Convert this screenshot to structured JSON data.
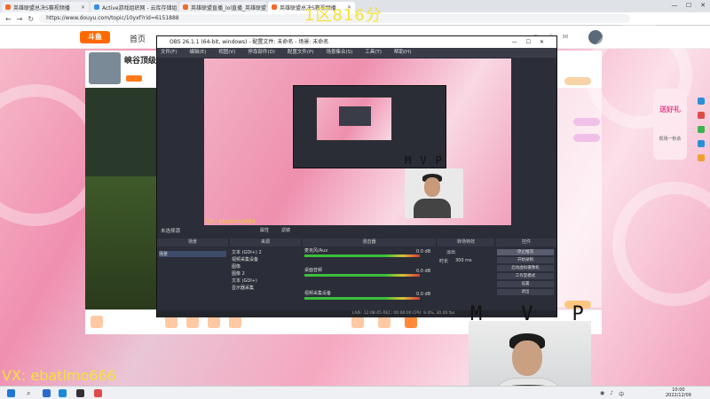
{
  "browser": {
    "tabs": [
      {
        "label": "英雄联盟总决S赛视频播"
      },
      {
        "label": "Active游戏组织网 - 云库存储组"
      },
      {
        "label": "英雄联盟直播_lol直播_英雄联盟"
      },
      {
        "label": "英雄联盟总决S赛视频播"
      }
    ],
    "url": "https://www.douyu.com/topic/10yxf?rid=6151888"
  },
  "site": {
    "logo": "斗鱼",
    "home": "首页",
    "streamer_title": "峡谷顶级",
    "streamer_tag": "主播"
  },
  "overlay": {
    "score": "1区816分",
    "mvp": "MVP",
    "vx": "VX: ebatimo666",
    "nest_vx": "VX: ebatimo666"
  },
  "obs": {
    "title": "OBS 26.1.1 (64-bit, windows) - 配置文件: 未命名 - 场景: 未命名",
    "menu": [
      "文件(F)",
      "编辑(E)",
      "视图(V)",
      "停靠部件(D)",
      "配置文件(P)",
      "场景集合(S)",
      "工具(T)",
      "帮助(H)"
    ],
    "no_source_selected": "未选择源",
    "properties": "属性",
    "filters": "滤镜",
    "panels": {
      "scenes": "场景",
      "sources": "来源",
      "mixer": "混音器",
      "transitions": "转场特效",
      "controls": "控件"
    },
    "scene_items": [
      "场景"
    ],
    "source_items": [
      "文本 (GDI+) 2",
      "视频采集设备",
      "图像",
      "图像 2",
      "文本 (GDI+)",
      "显示器采集"
    ],
    "mixer_items": [
      {
        "name": "桌面音频",
        "level": "0.0 dB"
      },
      {
        "name": "麦克风/Aux",
        "level": "0.0 dB"
      },
      {
        "name": "视频采集设备",
        "level": "0.0 dB"
      }
    ],
    "transition": "淡出",
    "duration_label": "时长",
    "duration": "300 ms",
    "controls": [
      "停止推流",
      "开始录制",
      "启动虚拟摄像机",
      "工作室模式",
      "设置",
      "退出"
    ],
    "status": "LIVE: 12:08:45  REC: 00:00:00  CPU: 9.4%, 30.00 fps"
  },
  "promo": {
    "title": "送好礼",
    "subtitle": "现场一秒杀"
  },
  "taskbar": {
    "search": "⌕",
    "time": "10:00",
    "date": "2022/12/09"
  }
}
